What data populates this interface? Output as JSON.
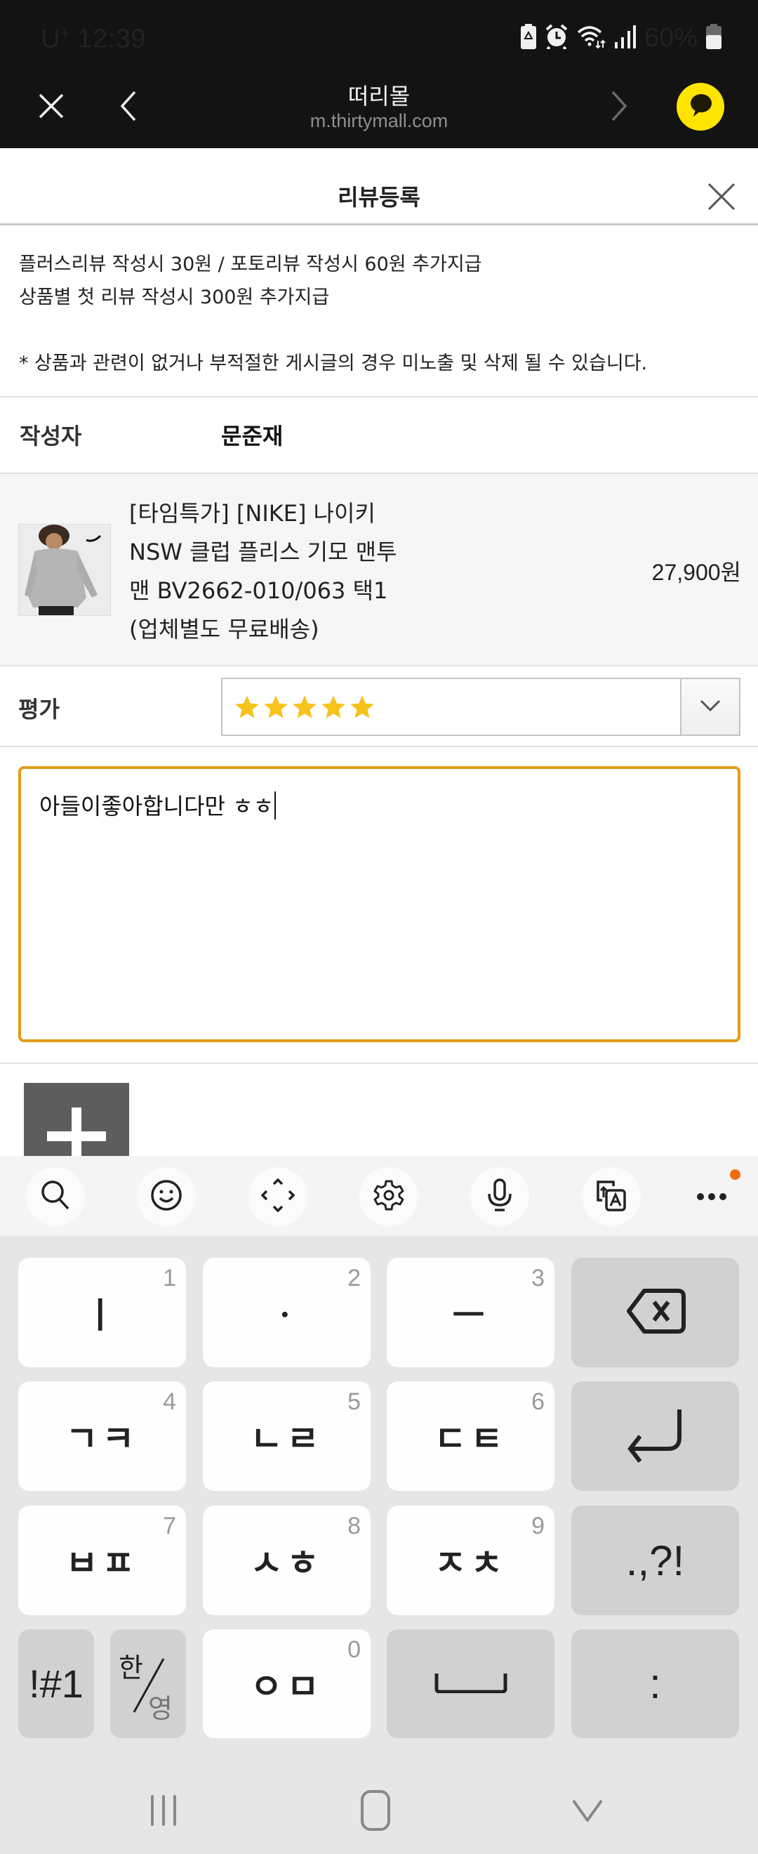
{
  "status_bar": {
    "carrier": "U",
    "carrier_sup": "+",
    "time": "12:39",
    "battery_percent": "60%",
    "icons": [
      "battery-saver-icon",
      "alarm-icon",
      "wifi-icon",
      "signal-icon",
      "battery-icon"
    ]
  },
  "browser": {
    "site_title": "떠리몰",
    "url": "m.thirtymall.com",
    "close_icon": "close-icon",
    "back_icon": "chevron-left-icon",
    "forward_icon": "chevron-right-icon",
    "chat_icon": "kakaotalk-icon"
  },
  "modal": {
    "title": "리뷰등록",
    "close_icon": "close-icon"
  },
  "notice": {
    "line1": "플러스리뷰 작성시 30원 / 포토리뷰 작성시 60원 추가지급",
    "line2": "상품별 첫 리뷰 작성시 300원 추가지급",
    "warning": "* 상품과 관련이 없거나 부적절한 게시글의 경우 미노출 및 삭제 될 수 있습니다."
  },
  "author": {
    "label": "작성자",
    "value": "문준재"
  },
  "product": {
    "name_lines": [
      "[타임특가] [NIKE] 나이키",
      "NSW 클럽 플리스 기모 맨투",
      "맨 BV2662-010/063 택1",
      "(업체별도 무료배송)"
    ],
    "price": "27,900원",
    "thumbnail_alt": "grey Nike crewneck sweatshirt"
  },
  "rating": {
    "label": "평가",
    "selected_stars": 5,
    "max_stars": 5,
    "star_color": "#f7c21b"
  },
  "review": {
    "text": "아들이좋아합니다만 ㅎㅎ",
    "border_color": "#e29c16"
  },
  "add_photo": {
    "icon": "plus-icon"
  },
  "keyboard": {
    "toolbar": [
      {
        "name": "search",
        "icon": "search-icon"
      },
      {
        "name": "emoji",
        "icon": "emoji-icon"
      },
      {
        "name": "cursor-move",
        "icon": "move-cursor-icon"
      },
      {
        "name": "settings",
        "icon": "gear-icon"
      },
      {
        "name": "voice",
        "icon": "microphone-icon"
      },
      {
        "name": "translate",
        "icon": "translate-icon"
      },
      {
        "name": "more",
        "icon": "more-dots-icon"
      }
    ],
    "badge_color": "#f36c12",
    "rows": [
      [
        {
          "label": "ㅣ",
          "num": "1"
        },
        {
          "label": "ㆍ",
          "num": "2"
        },
        {
          "label": "ㅡ",
          "num": "3"
        },
        {
          "label": "",
          "icon": "backspace-icon",
          "fn": true
        }
      ],
      [
        {
          "label": "ㄱㅋ",
          "num": "4"
        },
        {
          "label": "ㄴㄹ",
          "num": "5"
        },
        {
          "label": "ㄷㅌ",
          "num": "6"
        },
        {
          "label": "",
          "icon": "enter-icon",
          "fn": true
        }
      ],
      [
        {
          "label": "ㅂㅍ",
          "num": "7"
        },
        {
          "label": "ㅅㅎ",
          "num": "8"
        },
        {
          "label": "ㅈㅊ",
          "num": "9"
        },
        {
          "label": ".,?!",
          "fn": true
        }
      ],
      [
        {
          "label": "!#1",
          "fn": true
        },
        {
          "label_top": "한",
          "label_bottom": "영",
          "fn": true
        },
        {
          "label": "ㅇㅁ",
          "num": "0"
        },
        {
          "label": "",
          "icon": "space-icon",
          "fn": true
        },
        {
          "label": ":",
          "fn": true
        }
      ]
    ]
  },
  "nav_bar": {
    "recents_icon": "recent-apps-icon",
    "home_icon": "home-icon",
    "back_icon": "hide-keyboard-icon"
  }
}
